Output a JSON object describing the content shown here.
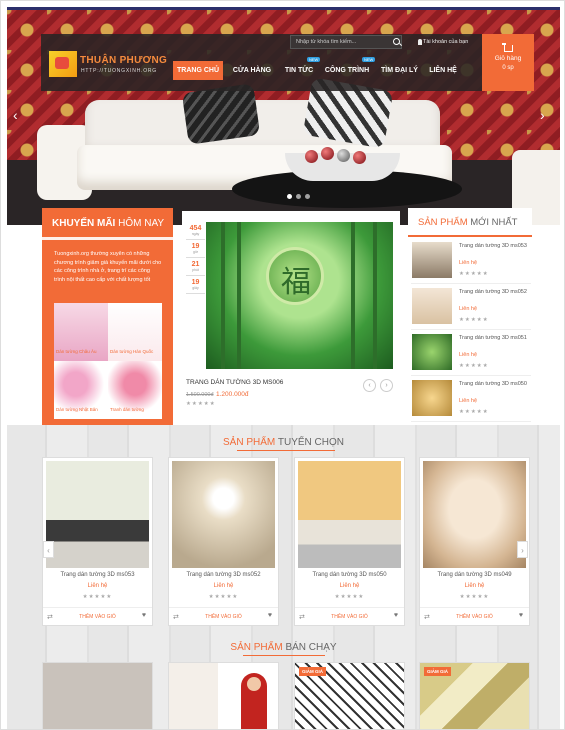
{
  "brand": {
    "name": "THUẬN PHƯƠNG",
    "tagline": "HTTP://TUONGXINH.ORG"
  },
  "header": {
    "search_placeholder": "Nhập từ khóa tìm kiếm...",
    "account_label": "Tài khoản của bạn",
    "cart_label": "Giỏ hàng",
    "cart_count": "0 sp",
    "nav": [
      {
        "label": "TRANG CHỦ",
        "active": true
      },
      {
        "label": "CỬA HÀNG"
      },
      {
        "label": "TIN TỨC",
        "badge": "NEW"
      },
      {
        "label": "CÔNG TRÌNH",
        "badge": "NEW"
      },
      {
        "label": "TÌM ĐẠI LÝ"
      },
      {
        "label": "LIÊN HỆ"
      }
    ]
  },
  "promo": {
    "title_bold": "KHUYẾN MÃI",
    "title_rest": "HÔM NAY",
    "text": "Tuongxinh.org thường xuyên có những chương trình giảm giá khuyến mãi dưới cho các công trình nhà ở, trang trí các công trình nội thất cao cấp với chất lượng tốt",
    "categories": [
      "Dán tường Châu Âu",
      "Dán tường Hàn Quốc",
      "Dán tường Nhật Bản",
      "Tranh dán tường"
    ]
  },
  "feature": {
    "countdown": [
      {
        "num": "454",
        "lbl": "ngày"
      },
      {
        "num": "19",
        "lbl": "giờ"
      },
      {
        "num": "21",
        "lbl": "phút"
      },
      {
        "num": "19",
        "lbl": "giây"
      }
    ],
    "name": "TRANG DÁN TƯỜNG 3D MS006",
    "old_price": "1.500.000đ",
    "price": "1.200.000đ",
    "stars": "★★★★★",
    "glyph": "福",
    "prev": "‹",
    "next": "›"
  },
  "newest": {
    "title_bold": "SẢN PHẨM",
    "title_rest": "MỚI NHẤT",
    "items": [
      {
        "name": "Trang dán tường 3D ms053",
        "contact": "Liên hệ",
        "stars": "★★★★★"
      },
      {
        "name": "Trang dán tường 3D ms052",
        "contact": "Liên hệ",
        "stars": "★★★★★"
      },
      {
        "name": "Trang dán tường 3D ms051",
        "contact": "Liên hệ",
        "stars": "★★★★★"
      },
      {
        "name": "Trang dán tường 3D ms050",
        "contact": "Liên hệ",
        "stars": "★★★★★"
      }
    ]
  },
  "selected": {
    "title_bold": "SẢN PHẨM",
    "title_rest": "TUYỂN CHỌN",
    "add_label": "THÊM VÀO GIỎ",
    "items": [
      {
        "name": "Trang dán tường 3D ms053",
        "contact": "Liên hệ",
        "stars": "★★★★★"
      },
      {
        "name": "Trang dán tường 3D ms052",
        "contact": "Liên hệ",
        "stars": "★★★★★"
      },
      {
        "name": "Trang dán tường 3D ms050",
        "contact": "Liên hệ",
        "stars": "★★★★★"
      },
      {
        "name": "Trang dán tường 3D ms049",
        "contact": "Liên hệ",
        "stars": "★★★★★"
      }
    ]
  },
  "bestseller": {
    "title_bold": "SẢN PHẨM",
    "title_rest": "BÁN CHẠY",
    "badge": "GIẢM GIÁ"
  },
  "icons": {
    "compare": "⇄",
    "heart": "♥",
    "hero_prev": "‹",
    "hero_next": "›"
  },
  "colors": {
    "accent": "#f26b37",
    "nav_bg": "#282424",
    "badge_new": "#2f9fe1"
  }
}
